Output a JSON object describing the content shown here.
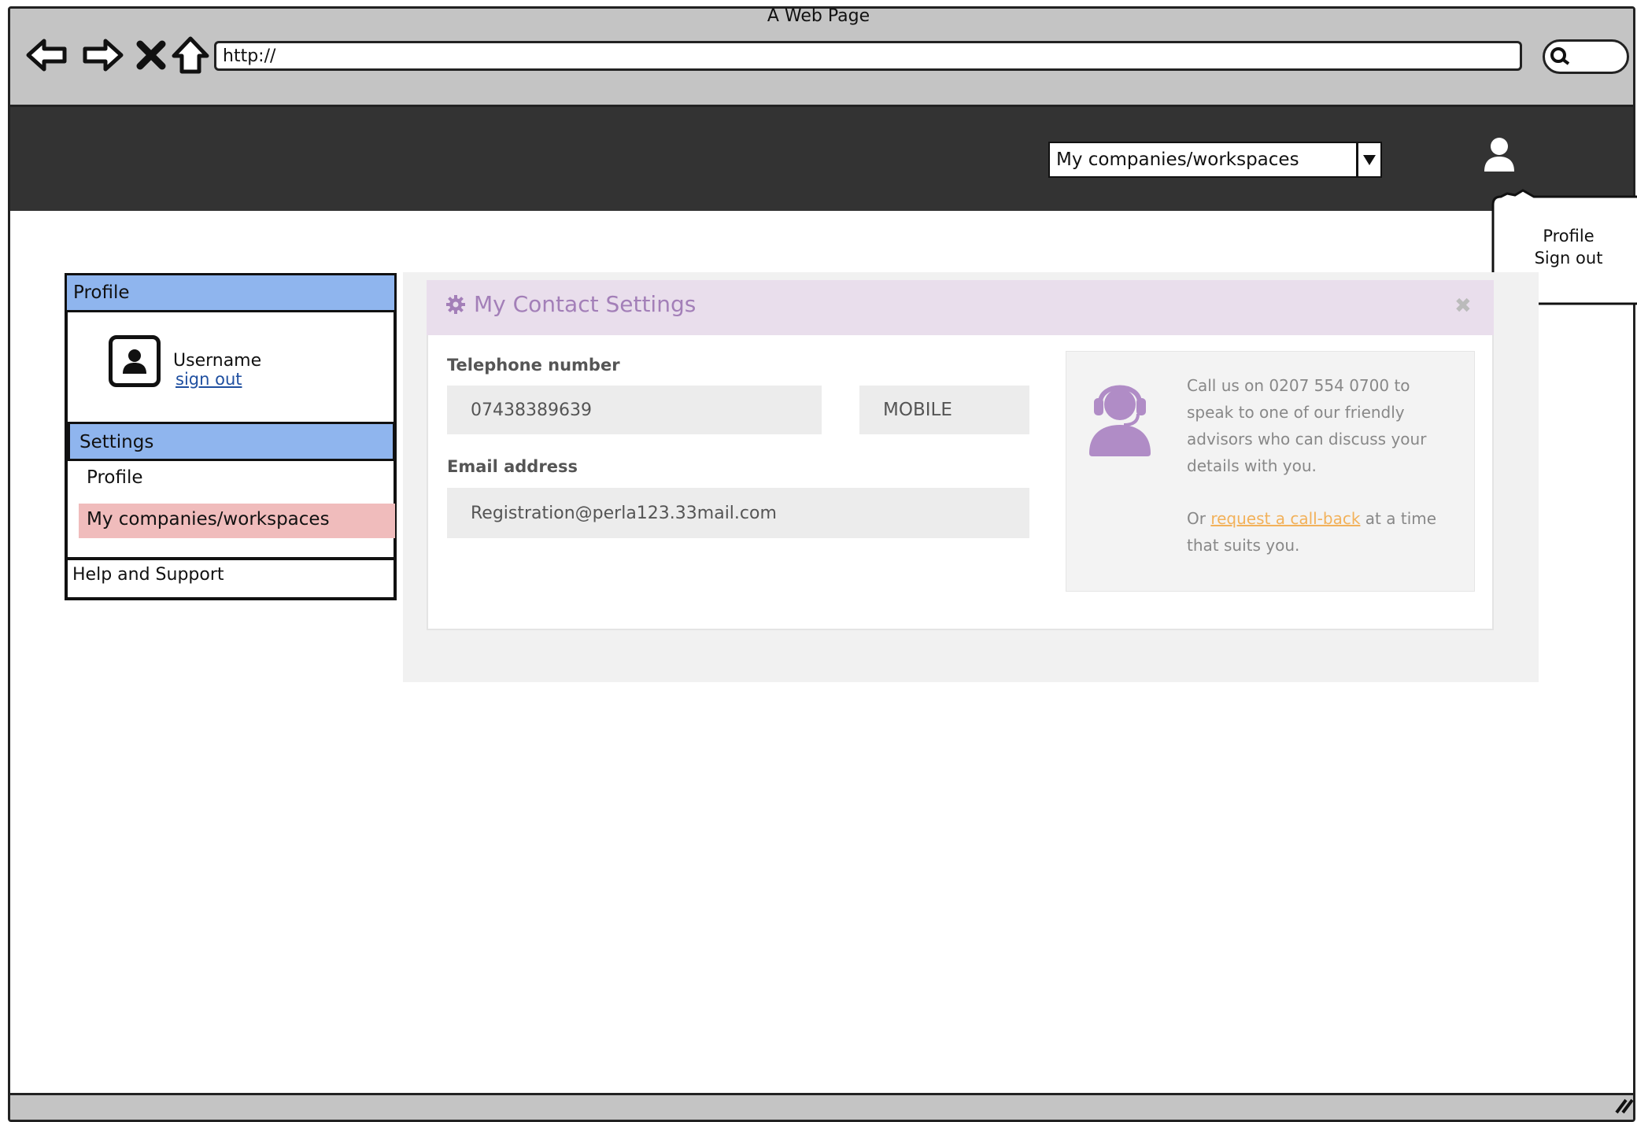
{
  "window": {
    "title": "A Web Page",
    "url": "http://"
  },
  "header": {
    "workspace_select_value": "My companies/workspaces"
  },
  "user_menu": {
    "items": [
      "Profile",
      "Sign out"
    ]
  },
  "sidebar": {
    "profile_heading": "Profile",
    "username": "Username",
    "sign_out": "sign out",
    "settings_heading": "Settings",
    "settings_items": [
      "Profile",
      "My companies/workspaces"
    ],
    "help": "Help and Support"
  },
  "panel": {
    "title": "My Contact Settings",
    "telephone_label": "Telephone number",
    "telephone_value": "07438389639",
    "phone_type": "MOBILE",
    "email_label": "Email address",
    "email_value": "Registration@perla123.33mail.com"
  },
  "help": {
    "lines": [
      "Call us on  0207 554 0700 to",
      "speak to one of our friendly",
      "advisors who can discuss your",
      "details with you."
    ],
    "callback_prefix": "Or ",
    "callback_link": "request a call-back",
    "callback_suffix": " at a time",
    "callback_line2": "that suits you."
  },
  "colors": {
    "header_bg": "#333333",
    "sidebar_heading": "#8fb5ee",
    "active_item": "#f0bcbc",
    "panel_header": "#e9deec",
    "accent_purple": "#a37fb8",
    "link_orange": "#f2b15a"
  },
  "icons": [
    "back-arrow-icon",
    "forward-arrow-icon",
    "stop-icon",
    "home-icon",
    "search-icon",
    "dropdown-arrow-icon",
    "user-icon",
    "gear-icon",
    "close-icon",
    "support-agent-icon",
    "resize-grip-icon"
  ]
}
